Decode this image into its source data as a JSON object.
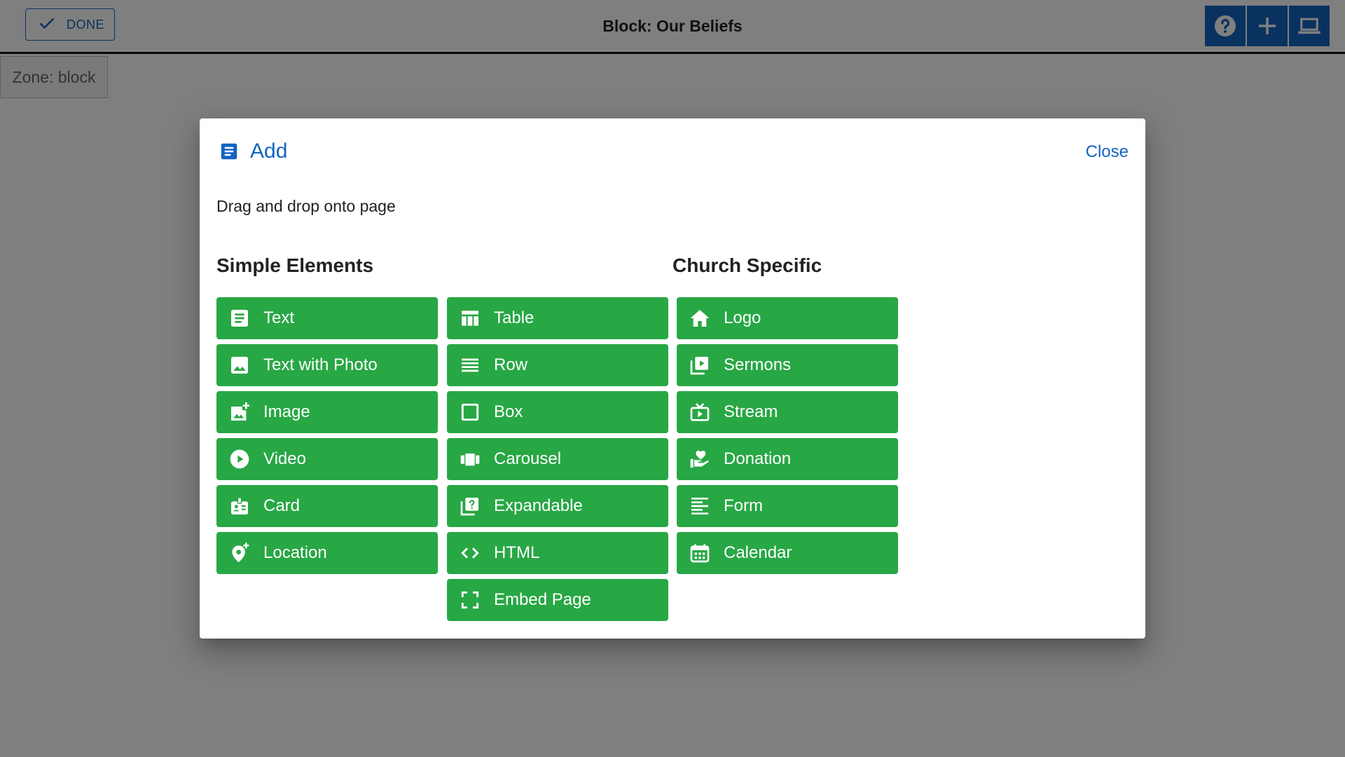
{
  "toolbar": {
    "done_label": "DONE",
    "title": "Block: Our Beliefs",
    "tools": [
      "help-icon",
      "add-icon",
      "laptop-icon"
    ]
  },
  "zone": {
    "label": "Zone: block"
  },
  "dialog": {
    "title": "Add",
    "close_label": "Close",
    "instruction": "Drag and drop onto page",
    "simple_title": "Simple Elements",
    "church_title": "Church Specific",
    "simple_col1": [
      {
        "label": "Text",
        "icon": "text-icon"
      },
      {
        "label": "Text with Photo",
        "icon": "photo-icon"
      },
      {
        "label": "Image",
        "icon": "add-photo-icon"
      },
      {
        "label": "Video",
        "icon": "play-circle-icon"
      },
      {
        "label": "Card",
        "icon": "badge-icon"
      },
      {
        "label": "Location",
        "icon": "add-location-icon"
      }
    ],
    "simple_col2": [
      {
        "label": "Table",
        "icon": "table-icon"
      },
      {
        "label": "Row",
        "icon": "rows-icon"
      },
      {
        "label": "Box",
        "icon": "box-icon"
      },
      {
        "label": "Carousel",
        "icon": "carousel-icon"
      },
      {
        "label": "Expandable",
        "icon": "expandable-icon"
      },
      {
        "label": "HTML",
        "icon": "code-icon"
      },
      {
        "label": "Embed Page",
        "icon": "fullscreen-icon"
      }
    ],
    "church": [
      {
        "label": "Logo",
        "icon": "home-icon"
      },
      {
        "label": "Sermons",
        "icon": "video-library-icon"
      },
      {
        "label": "Stream",
        "icon": "live-tv-icon"
      },
      {
        "label": "Donation",
        "icon": "volunteer-icon"
      },
      {
        "label": "Form",
        "icon": "form-icon"
      },
      {
        "label": "Calendar",
        "icon": "calendar-icon"
      }
    ]
  },
  "colors": {
    "primary": "#1565c0",
    "element_button": "#28a745",
    "overlay": "rgba(0,0,0,0.5)"
  }
}
